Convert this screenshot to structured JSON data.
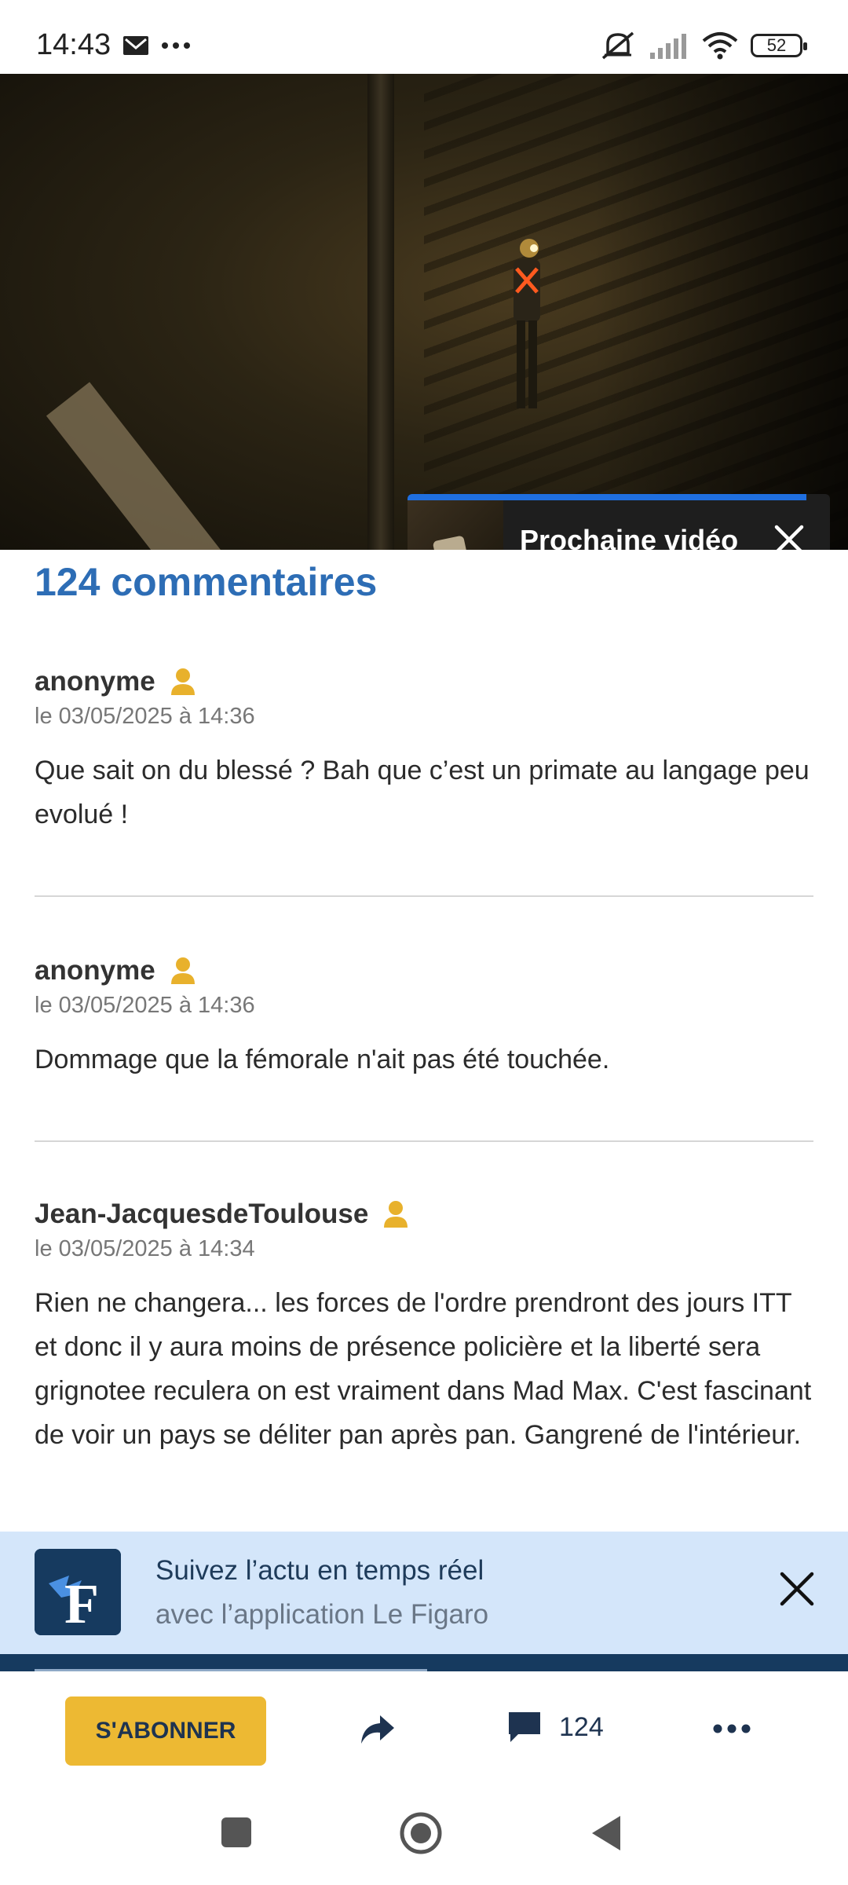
{
  "status_bar": {
    "time": "14:43",
    "battery": "52",
    "icons": [
      "mail-icon",
      "more-dots-icon",
      "mute-icon",
      "signal-icon",
      "wifi-icon",
      "battery-icon"
    ]
  },
  "video": {
    "next_label": "Prochaine vidéo"
  },
  "comments": {
    "title": "124 commentaires",
    "items": [
      {
        "author": "anonyme",
        "date": "le 03/05/2025 à 14:36",
        "text": "Que sait on du blessé ? Bah que c’est un primate au langage peu evolué !"
      },
      {
        "author": "anonyme",
        "date": "le 03/05/2025 à 14:36",
        "text": "Dommage que la fémorale n'ait pas été touchée."
      },
      {
        "author": "Jean-JacquesdeToulouse",
        "date": "le 03/05/2025 à 14:34",
        "text": "Rien ne changera... les forces de l'ordre prendront des jours ITT et donc il y aura moins de présence policière et la liberté sera grignotee reculera on est vraiment dans Mad Max. C'est fascinant de voir un pays se déliter pan après pan. Gangrené de l'intérieur."
      }
    ]
  },
  "banner": {
    "title": "Suivez l’actu en temps réel",
    "subtitle": "avec l’application Le Figaro",
    "logo_letter": "F"
  },
  "toolbar": {
    "subscribe_label": "S'ABONNER",
    "comment_count": "124"
  },
  "colors": {
    "accent_blue": "#2d6db5",
    "subscribe_yellow": "#edb933",
    "banner_bg": "#d4e6fa",
    "navy": "#163a5f",
    "user_icon": "#e8b12c"
  }
}
